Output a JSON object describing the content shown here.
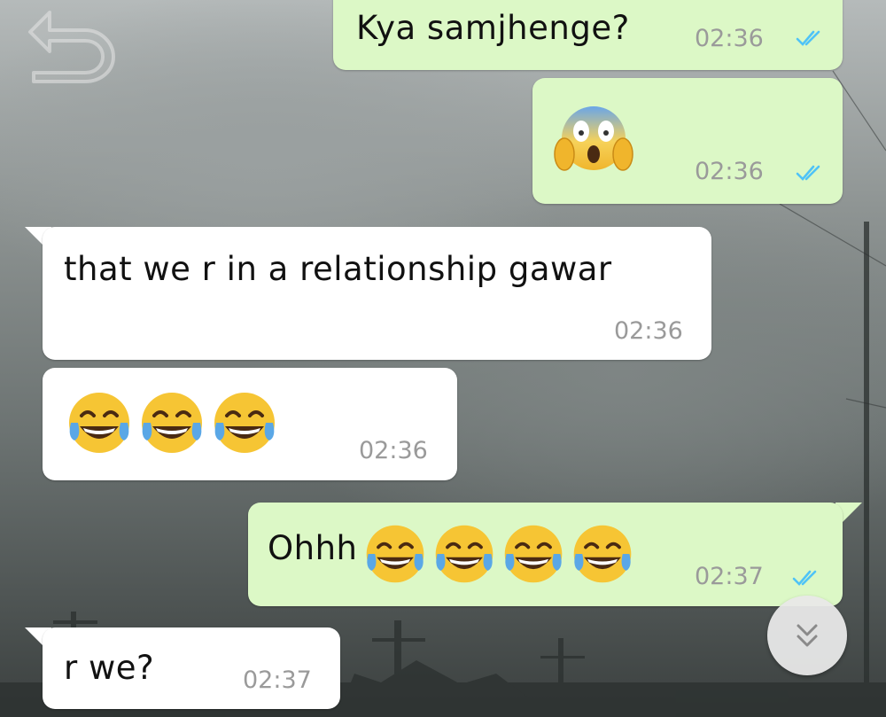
{
  "chat": {
    "messages": [
      {
        "direction": "outgoing",
        "text": "Kya samjhenge?",
        "time": "02:36",
        "status": "read"
      },
      {
        "direction": "outgoing",
        "emoji": "face-screaming-in-fear",
        "time": "02:36",
        "status": "read"
      },
      {
        "direction": "incoming",
        "text": "that we r in a relationship gawar",
        "time": "02:36"
      },
      {
        "direction": "incoming",
        "emoji": "face-with-tears-of-joy x3",
        "time": "02:36"
      },
      {
        "direction": "outgoing",
        "text": "Ohhh",
        "emoji": "face-with-tears-of-joy x4",
        "time": "02:37",
        "status": "read"
      },
      {
        "direction": "incoming",
        "text": "r we?",
        "time": "02:37"
      }
    ]
  },
  "icons": {
    "back": "back-arrow-icon",
    "read_receipt": "double-check-icon",
    "scroll_down": "double-chevron-down-icon"
  },
  "colors": {
    "outgoing_bubble": "#dcf8c6",
    "incoming_bubble": "#ffffff",
    "read_ticks": "#4fc3f7",
    "timestamp": "#9a9a9a"
  }
}
